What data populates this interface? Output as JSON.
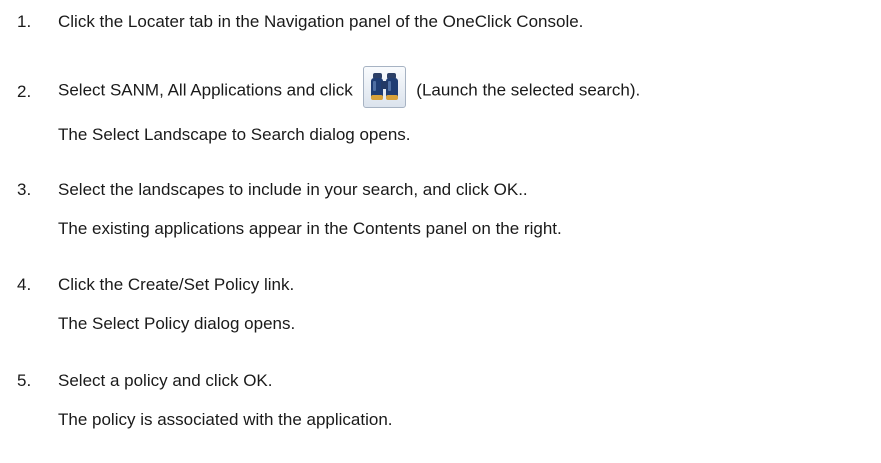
{
  "steps": [
    {
      "number": "1.",
      "text": "Click the Locater tab in the Navigation panel of the OneClick Console."
    },
    {
      "number": "2.",
      "text_before": "Select SANM, All Applications and click",
      "icon": "binoculars-icon",
      "text_after": "(Launch the selected search).",
      "result": "The Select Landscape to Search dialog opens."
    },
    {
      "number": "3.",
      "text": "Select the landscapes to include in your search, and click OK..",
      "result": "The existing applications appear in the Contents panel on the right."
    },
    {
      "number": "4.",
      "text": "Click the Create/Set Policy link.",
      "result": "The Select Policy dialog opens."
    },
    {
      "number": "5.",
      "text": "Select a policy and click OK.",
      "result": "The policy is associated with the application."
    }
  ]
}
